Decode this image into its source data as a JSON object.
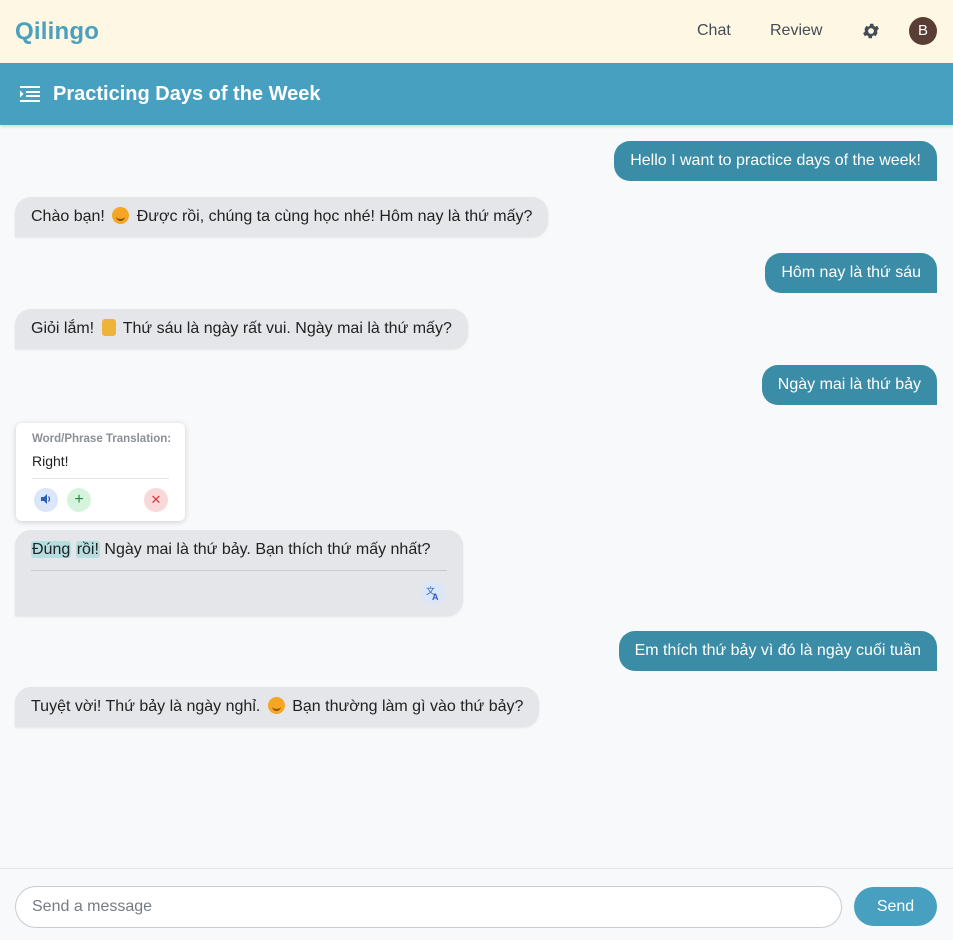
{
  "app": {
    "brand": "Qilingo"
  },
  "nav": {
    "chat": "Chat",
    "review": "Review",
    "avatar_initial": "B"
  },
  "conversation": {
    "title": "Practicing Days of the Week"
  },
  "messages": [
    {
      "role": "user",
      "text": "Hello I want to practice days of the week!"
    },
    {
      "role": "bot",
      "parts": [
        "Chào bạn!",
        "Được rồi, chúng ta cùng học nhé! Hôm nay là thứ mấy?"
      ],
      "emoji": "smile-emoji"
    },
    {
      "role": "user",
      "text": "Hôm nay là thứ sáu"
    },
    {
      "role": "bot",
      "parts": [
        "Giỏi lắm!",
        "Thứ sáu là ngày rất vui. Ngày mai là thứ mấy?"
      ],
      "emoji": "thumbs-up-emoji"
    },
    {
      "role": "user",
      "text": "Ngày mai là thứ bảy"
    },
    {
      "role": "bot",
      "highlight": [
        "Đúng",
        "rồi!"
      ],
      "text": "Ngày mai là thứ bảy. Bạn thích thứ mấy nhất?"
    },
    {
      "role": "user",
      "text": "Em thích thứ bảy vì đó là ngày cuối tuần"
    },
    {
      "role": "bot",
      "parts": [
        "Tuyệt vời! Thứ bảy là ngày nghỉ.",
        "Bạn thường làm gì vào thứ bảy?"
      ],
      "emoji": "smile-emoji"
    }
  ],
  "translation_popup": {
    "label": "Word/Phrase Translation:",
    "text": "Right!",
    "icons": [
      "speaker-icon",
      "plus-icon",
      "close-icon"
    ]
  },
  "composer": {
    "placeholder": "Send a message",
    "value": "",
    "send_label": "Send"
  },
  "colors": {
    "brand": "#4aa0be",
    "titlebar": "#48a0c0",
    "user_bubble": "#3b8ca6",
    "bot_bubble": "#e5e6e9",
    "topbar": "#fdf7e3"
  }
}
